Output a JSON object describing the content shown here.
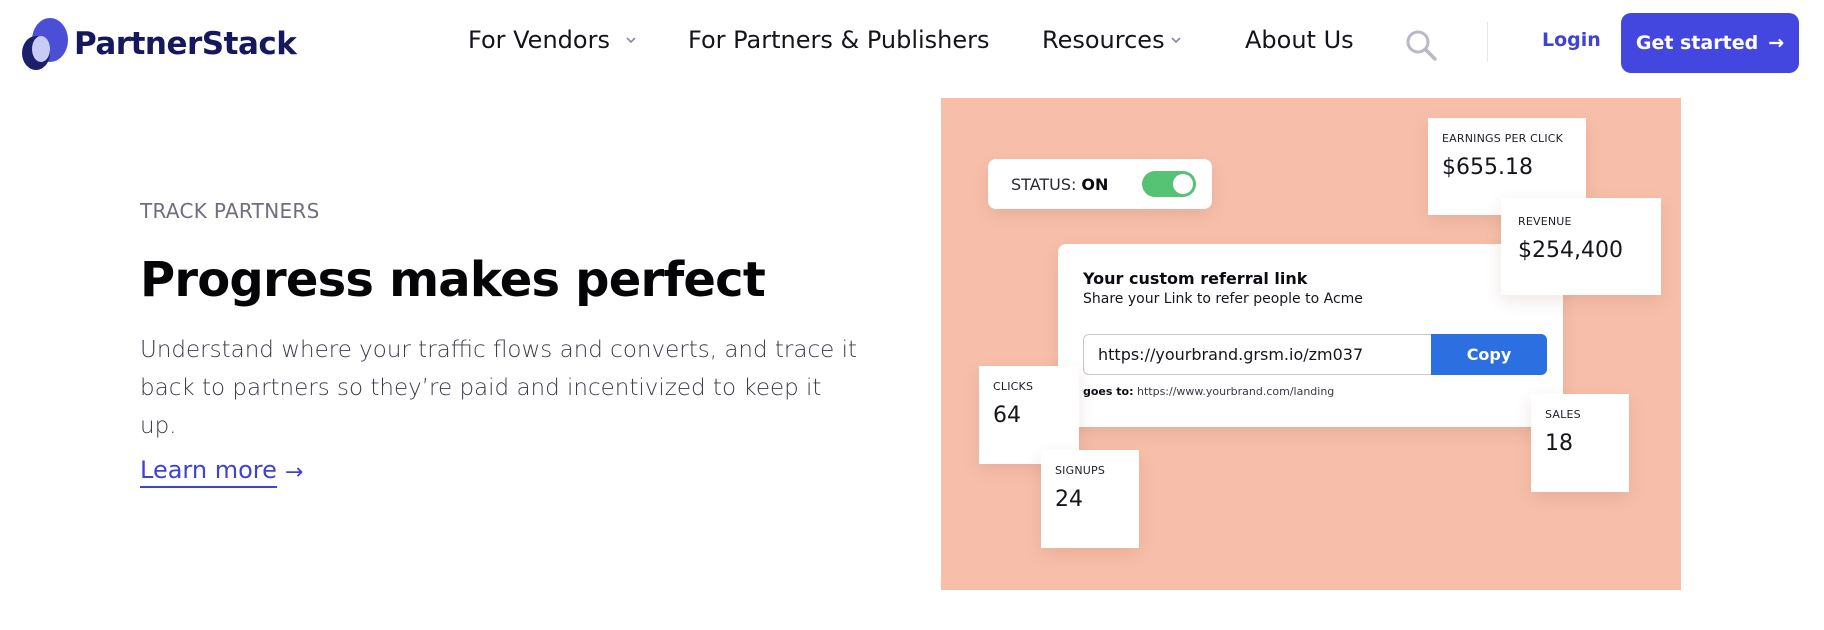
{
  "header": {
    "brand": "PartnerStack",
    "nav": [
      {
        "label": "For Vendors",
        "has_dropdown": true
      },
      {
        "label": "For Partners & Publishers",
        "has_dropdown": false
      },
      {
        "label": "Resources",
        "has_dropdown": true
      },
      {
        "label": "About Us",
        "has_dropdown": false
      }
    ],
    "login_label": "Login",
    "cta_label": "Get started",
    "cta_arrow": "→",
    "icons": [
      "search-icon",
      "chevron-down-icon",
      "arrow-right-icon"
    ]
  },
  "hero": {
    "eyebrow": "TRACK PARTNERS",
    "title": "Progress makes perfect",
    "description": "Understand where your traffic flows and converts, and trace it back to partners so they’re paid and incentivized to keep it up.",
    "link_label": "Learn more",
    "link_arrow": "→"
  },
  "illustration": {
    "status_label": "STATUS:",
    "status_value": "ON",
    "toggle_on": true,
    "referral": {
      "title": "Your custom referral link",
      "subtitle": "Share your Link to refer people to Acme",
      "url": "https://yourbrand.grsm.io/zm037",
      "copy_label": "Copy",
      "goes_to_label": "goes to:",
      "goes_to_url": "https://www.yourbrand.com/landing"
    },
    "metrics": {
      "epc": {
        "label": "EARNINGS PER CLICK",
        "value": "$655.18"
      },
      "revenue": {
        "label": "REVENUE",
        "value": "$254,400"
      },
      "clicks": {
        "label": "CLICKS",
        "value": "64"
      },
      "signups": {
        "label": "SIGNUPS",
        "value": "24"
      },
      "sales": {
        "label": "SALES",
        "value": "18"
      }
    }
  },
  "colors": {
    "brand_primary": "#4446e0",
    "brand_dark": "#16185e",
    "panel_bg": "#f7bfa9",
    "toggle_on": "#56c274",
    "copy_button": "#2b6fe0"
  }
}
